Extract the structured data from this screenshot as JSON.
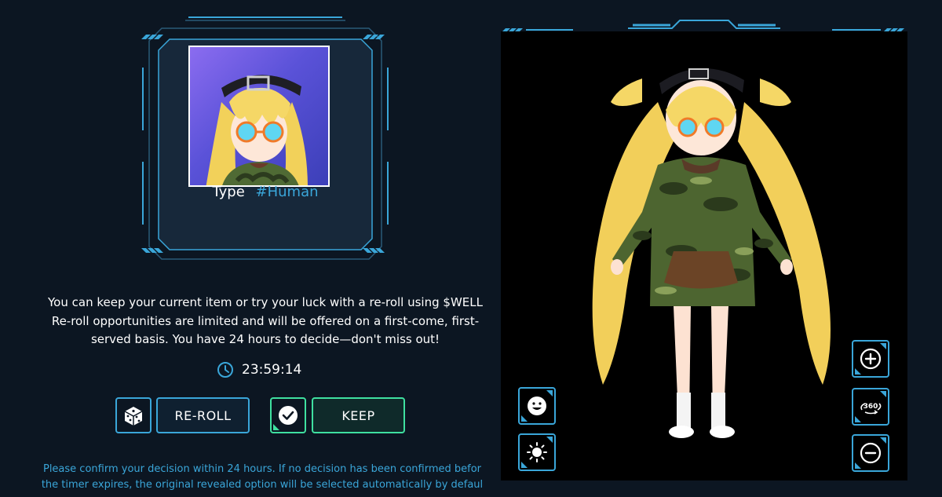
{
  "card": {
    "type_label": "Type",
    "type_value": "#Human"
  },
  "info": {
    "line1": "You can keep your current item or try your luck with a re-roll using $WELL",
    "line2": "Re-roll opportunities are limited and will be offered on a first-come, first-",
    "line3": "served basis. You have 24 hours to decide—don't miss out!"
  },
  "timer": {
    "icon": "clock-icon",
    "value": "23:59:14"
  },
  "actions": {
    "reroll_icon": "dice-icon",
    "reroll_label": "RE-ROLL",
    "keep_icon": "check-icon",
    "keep_label": "KEEP"
  },
  "note": {
    "line1": "Please confirm your decision within 24 hours. If no decision has been confirmed befor",
    "line2": "the timer expires, the original revealed option will be selected automatically by defaul"
  },
  "viewer_controls": {
    "emote": "smiley-icon",
    "light": "sun-icon",
    "zoom_in": "plus-icon",
    "rotate": "rotate-360-icon",
    "rotate_text": "360",
    "zoom_out": "minus-icon"
  },
  "colors": {
    "background": "#0c1622",
    "accent_blue": "#3aa6d9",
    "accent_green": "#3fe0a0",
    "viewer_bg": "#000000"
  }
}
